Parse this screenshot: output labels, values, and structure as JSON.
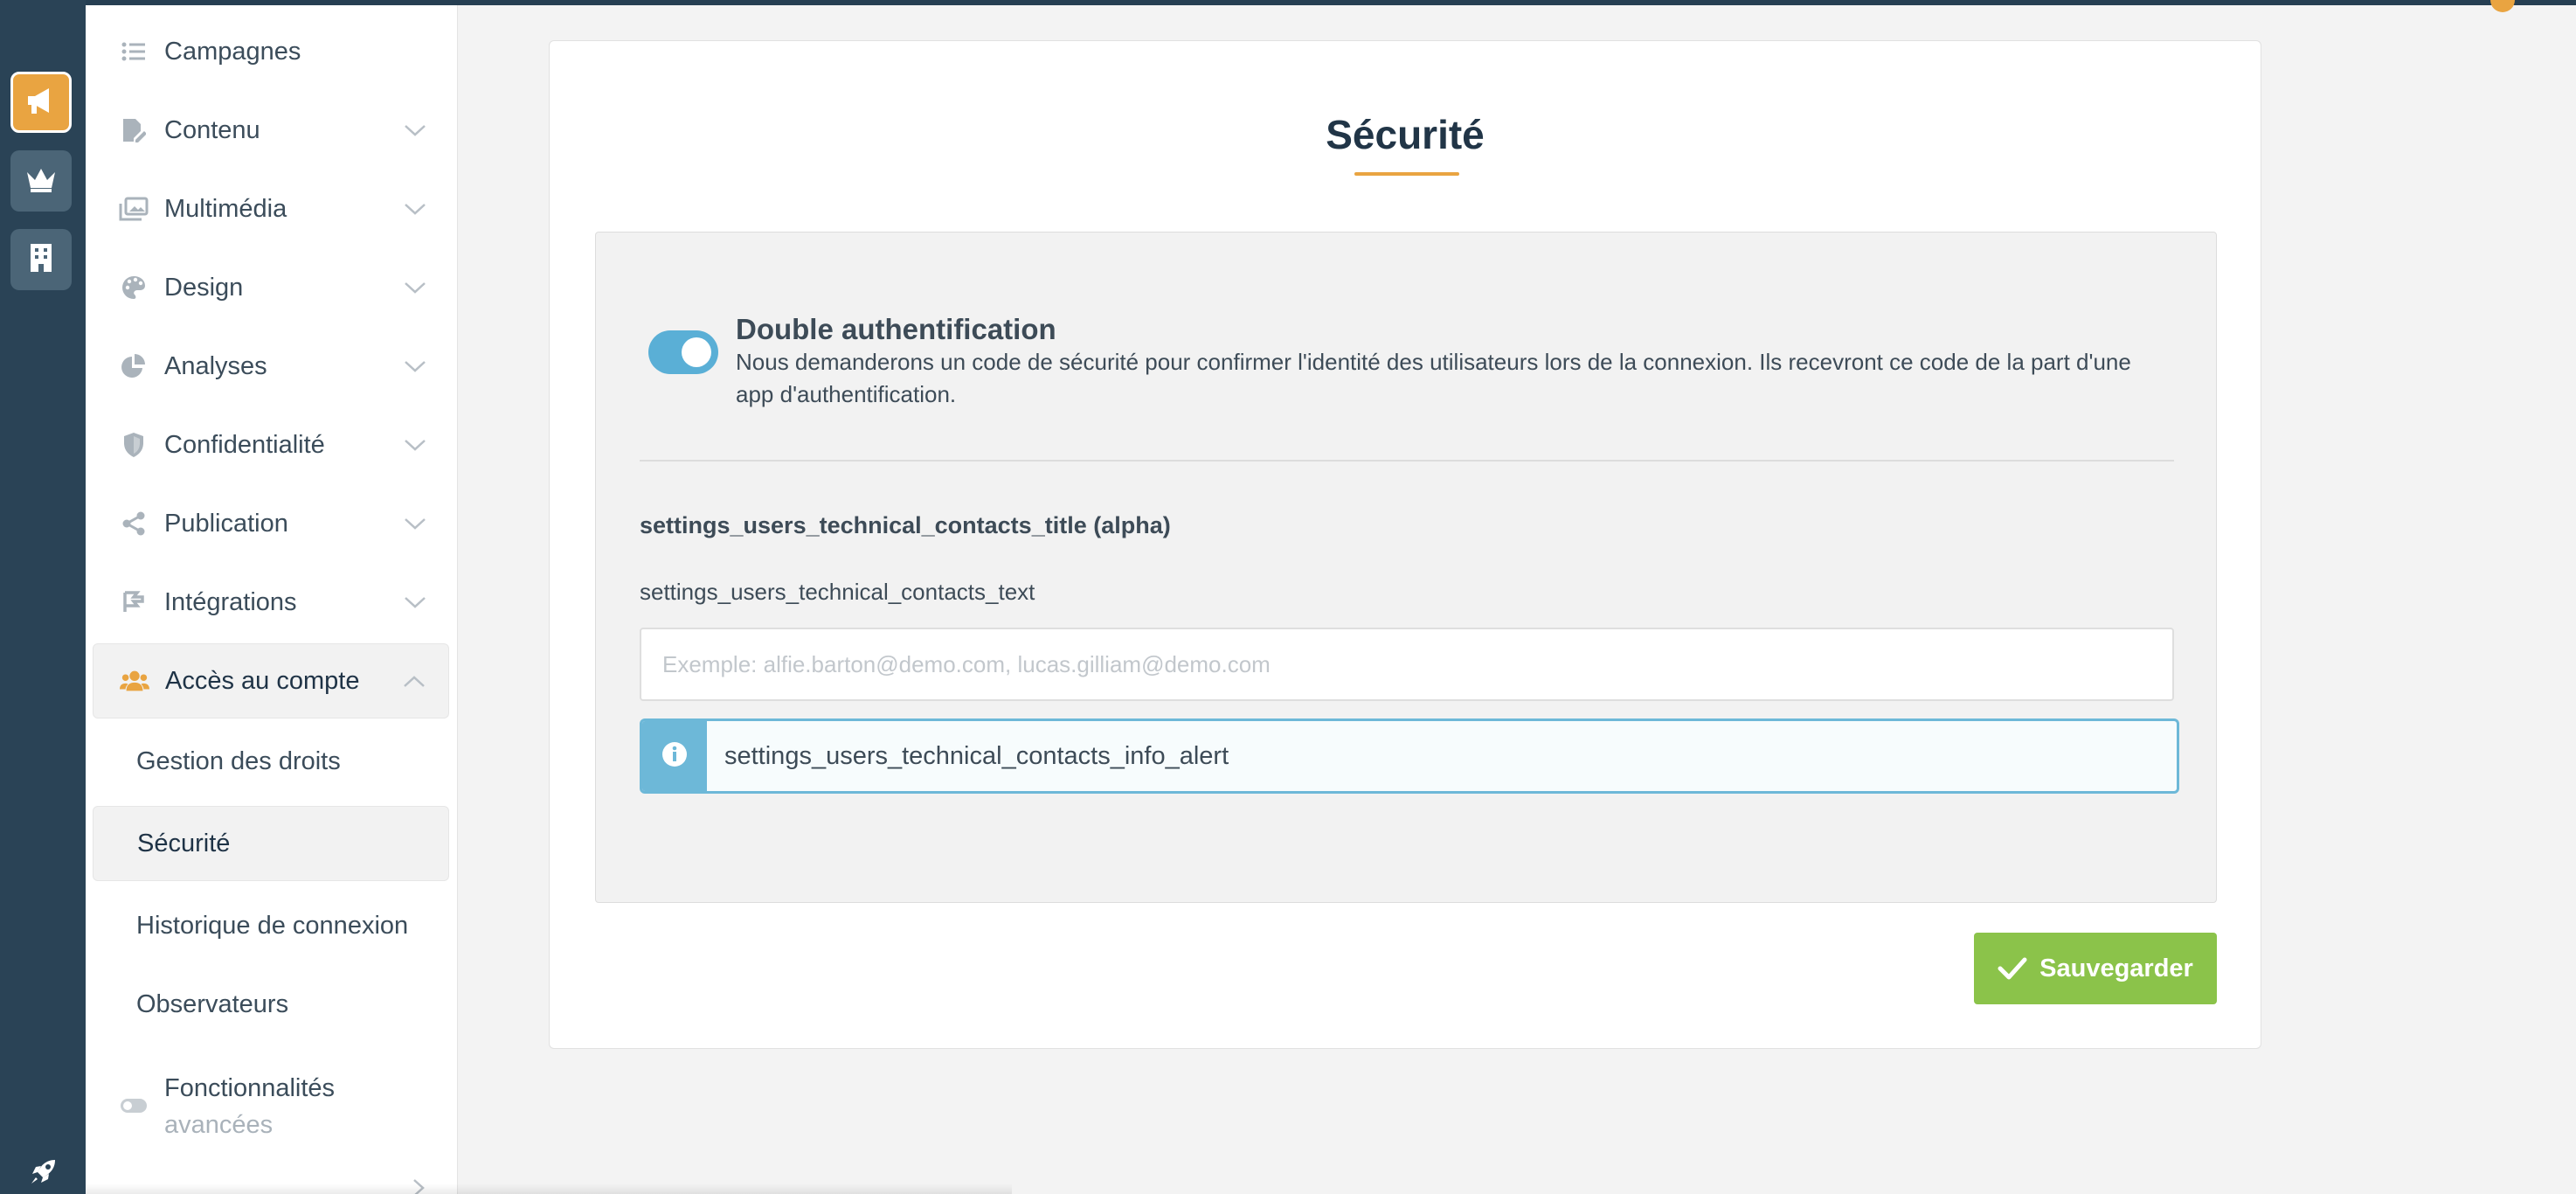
{
  "rail": {
    "items": [
      {
        "icon": "megaphone-icon",
        "active": true
      },
      {
        "icon": "crown-icon",
        "active": false
      },
      {
        "icon": "building-icon",
        "active": false
      }
    ],
    "bottom_icon": "rocket-icon"
  },
  "sidebar": {
    "items": [
      {
        "label": "Campagnes",
        "icon": "list-icon"
      },
      {
        "label": "Contenu",
        "icon": "edit-file-icon"
      },
      {
        "label": "Multimédia",
        "icon": "images-icon"
      },
      {
        "label": "Design",
        "icon": "palette-icon"
      },
      {
        "label": "Analyses",
        "icon": "pie-chart-icon"
      },
      {
        "label": "Confidentialité",
        "icon": "shield-icon"
      },
      {
        "label": "Publication",
        "icon": "share-icon"
      },
      {
        "label": "Intégrations",
        "icon": "plug-icon"
      },
      {
        "label": "Accès au compte",
        "icon": "users-icon"
      }
    ],
    "subitems": [
      {
        "label": "Gestion des droits"
      },
      {
        "label": "Sécurité"
      },
      {
        "label": "Historique de connexion"
      },
      {
        "label": "Observateurs"
      }
    ],
    "advanced": {
      "line1": "Fonctionnalités",
      "line2": "avancées",
      "icon": "toggle-icon"
    }
  },
  "page": {
    "title": "Sécurité",
    "accent_color": "#e9a441"
  },
  "two_factor": {
    "enabled": true,
    "title": "Double authentification",
    "description": "Nous demanderons un code de sécurité pour confirmer l'identité des utilisateurs lors de la connexion. Ils recevront ce code de la part d'une app d'authentification."
  },
  "contacts": {
    "title": "settings_users_technical_contacts_title (alpha)",
    "text": "settings_users_technical_contacts_text",
    "input_value": "",
    "input_placeholder": "Exemple: alfie.barton@demo.com, lucas.gilliam@demo.com",
    "alert": "settings_users_technical_contacts_info_alert"
  },
  "actions": {
    "save_label": "Sauvegarder",
    "save_color": "#8bc34a"
  }
}
